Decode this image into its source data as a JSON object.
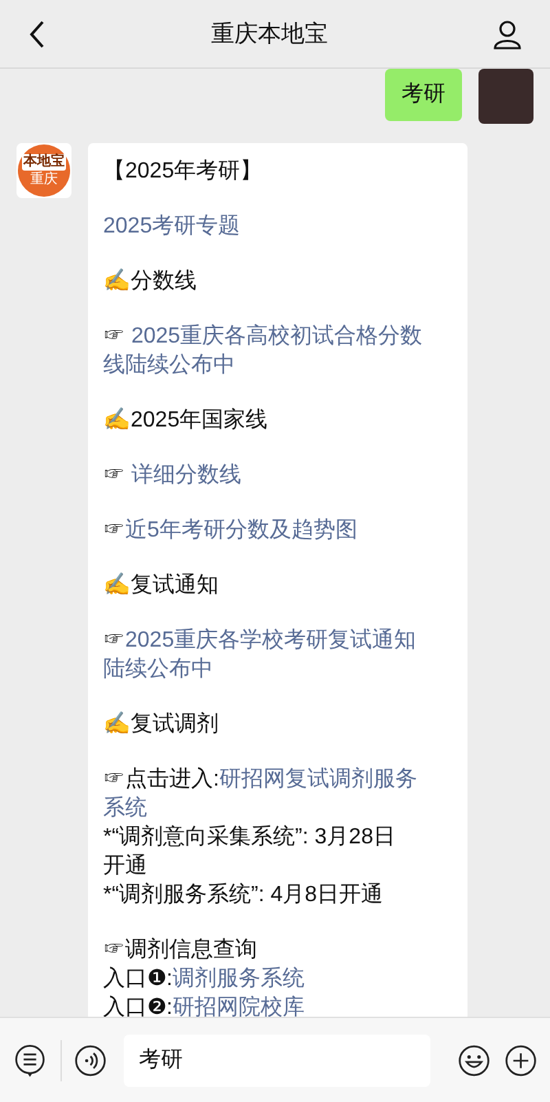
{
  "header": {
    "title": "重庆本地宝"
  },
  "messages": [
    {
      "kind": "sent",
      "text": "考研"
    },
    {
      "kind": "received",
      "logo": {
        "top": "本地宝",
        "bottom": "重庆"
      },
      "paragraphs": [
        [
          [
            {
              "text": "【2025年考研】",
              "link": false
            }
          ]
        ],
        [
          [
            {
              "text": "2025考研专题",
              "link": true
            }
          ]
        ],
        [
          [
            {
              "text": "✍️分数线",
              "link": false
            }
          ]
        ],
        [
          [
            {
              "text": "☞ ",
              "link": false
            },
            {
              "text": "2025重庆各高校初试合格分数",
              "link": true
            }
          ],
          [
            {
              "text": "线陆续公布中",
              "link": true
            }
          ]
        ],
        [
          [
            {
              "text": "✍️2025年国家线",
              "link": false
            }
          ]
        ],
        [
          [
            {
              "text": "☞ ",
              "link": false
            },
            {
              "text": "详细分数线",
              "link": true
            }
          ]
        ],
        [
          [
            {
              "text": "☞",
              "link": false
            },
            {
              "text": "近5年考研分数及趋势图",
              "link": true
            }
          ]
        ],
        [
          [
            {
              "text": "✍️复试通知",
              "link": false
            }
          ]
        ],
        [
          [
            {
              "text": "☞",
              "link": false
            },
            {
              "text": "2025重庆各学校考研复试通知",
              "link": true
            }
          ],
          [
            {
              "text": "陆续公布中",
              "link": true
            }
          ]
        ],
        [
          [
            {
              "text": "✍️复试调剂",
              "link": false
            }
          ]
        ],
        [
          [
            {
              "text": "☞点击进入:",
              "link": false
            },
            {
              "text": "研招网复试调剂服务",
              "link": true
            }
          ],
          [
            {
              "text": "系统",
              "link": true
            }
          ],
          [
            {
              "text": "*“调剂意向采集系统”: 3月28日",
              "link": false
            }
          ],
          [
            {
              "text": "开通",
              "link": false
            }
          ],
          [
            {
              "text": "*“调剂服务系统”: 4月8日开通",
              "link": false
            }
          ]
        ],
        [
          [
            {
              "text": "☞调剂信息查询",
              "link": false
            }
          ],
          [
            {
              "text": "入口❶:",
              "link": false
            },
            {
              "text": "调剂服务系统",
              "link": true
            }
          ],
          [
            {
              "text": "入口❷:",
              "link": false
            },
            {
              "text": "研招网院校库",
              "link": true
            }
          ]
        ]
      ]
    }
  ],
  "input": {
    "value": "考研"
  }
}
